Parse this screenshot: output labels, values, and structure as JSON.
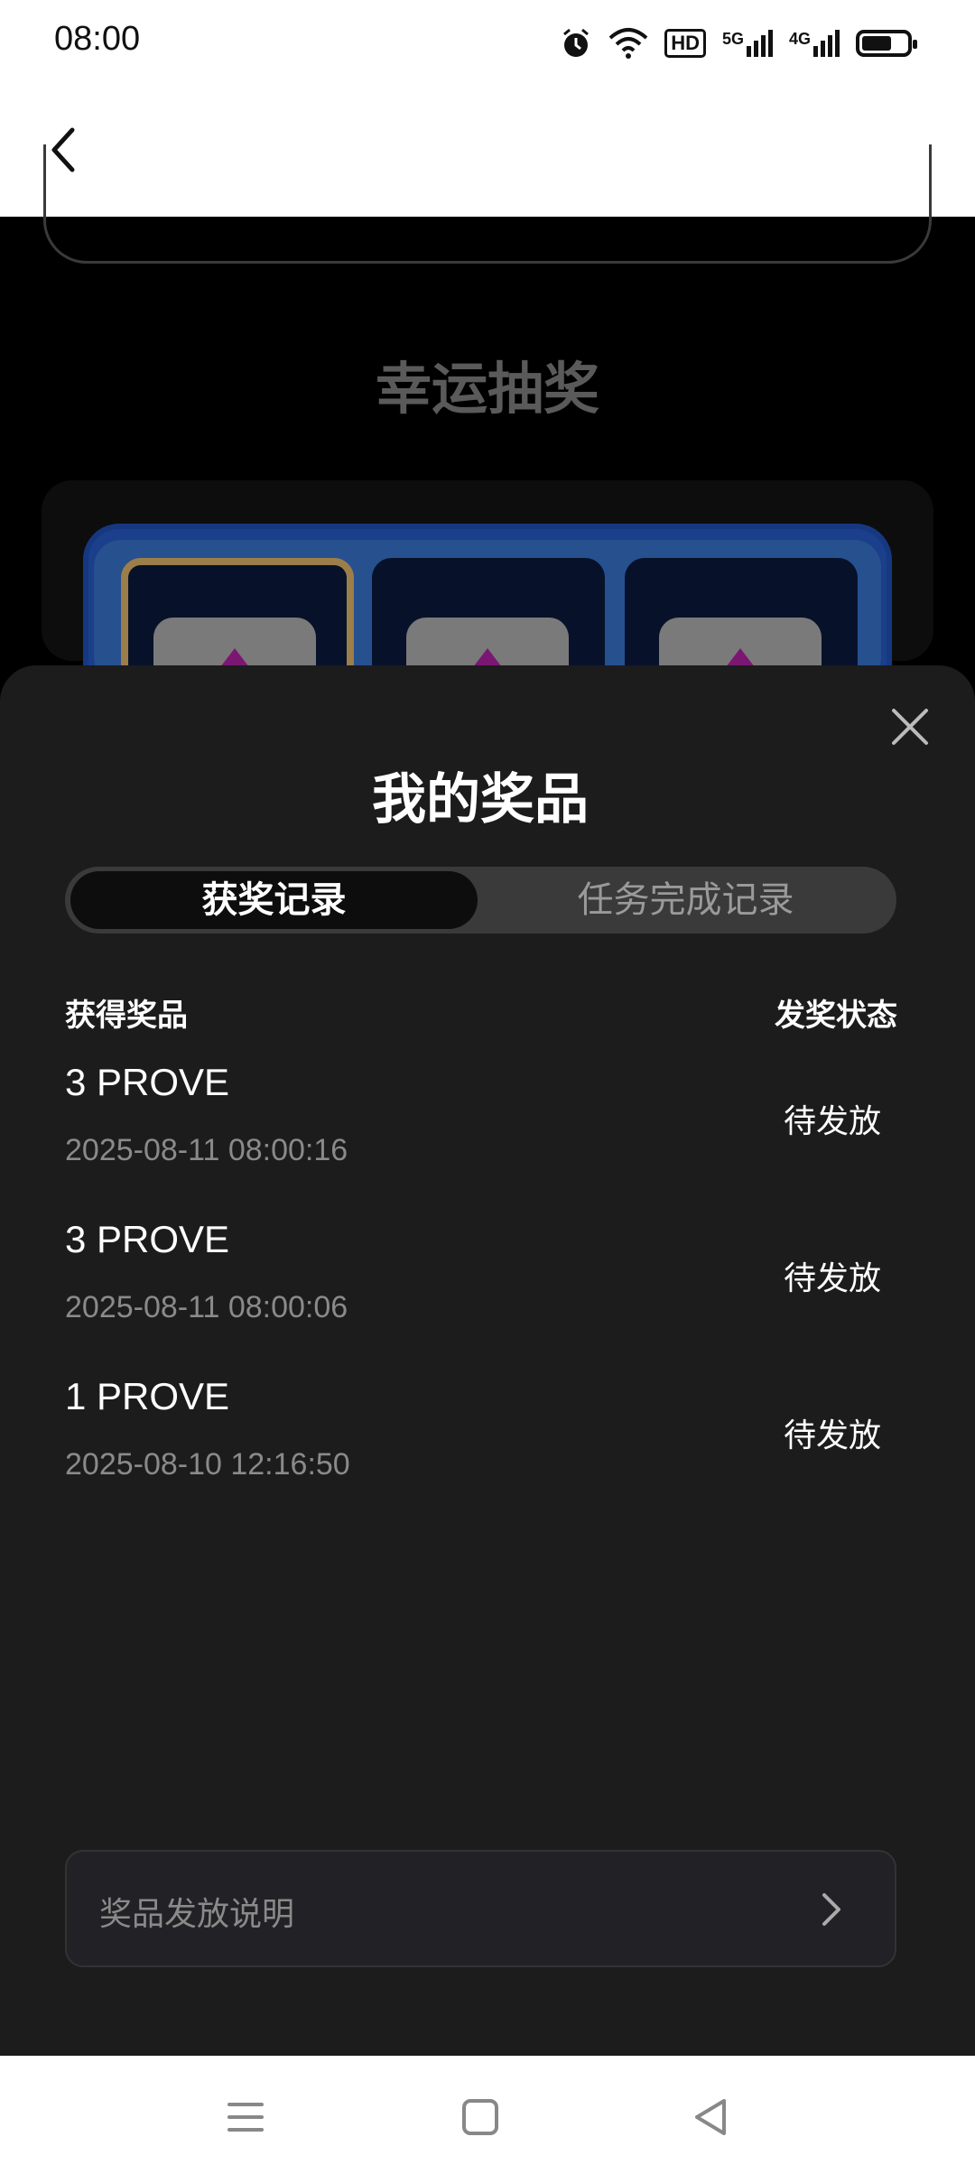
{
  "status_bar": {
    "time": "08:00",
    "icons": [
      "alarm-icon",
      "wifi-icon",
      "hd-icon",
      "signal-5g-icon",
      "signal-4g-icon",
      "battery-icon"
    ],
    "hd_label": "HD",
    "net1": "5G",
    "net2": "4G"
  },
  "header": {
    "back_icon": "back-chevron-icon"
  },
  "background": {
    "section_title": "幸运抽奖"
  },
  "sheet": {
    "title": "我的奖品",
    "tabs": [
      {
        "label": "获奖记录",
        "active": true
      },
      {
        "label": "任务完成记录",
        "active": false
      }
    ],
    "columns": {
      "prize": "获得奖品",
      "status": "发奖状态"
    },
    "records": [
      {
        "prize": "3 PROVE",
        "date": "2025-08-11 08:00:16",
        "status": "待发放"
      },
      {
        "prize": "3 PROVE",
        "date": "2025-08-11 08:00:06",
        "status": "待发放"
      },
      {
        "prize": "1 PROVE",
        "date": "2025-08-10 12:16:50",
        "status": "待发放"
      }
    ],
    "info_link": "奖品发放说明"
  },
  "nav": {
    "icons": [
      "menu-icon",
      "home-icon",
      "back-icon"
    ]
  },
  "colors": {
    "sheet_bg": "#1c1c1d",
    "tab_active_bg": "#0d0d0d",
    "tab_track_bg": "#3a3a3b",
    "muted_text": "#8a8a8a",
    "slot_border_gold": "#9c7e4a",
    "board_blue": "#1b3f8a"
  }
}
